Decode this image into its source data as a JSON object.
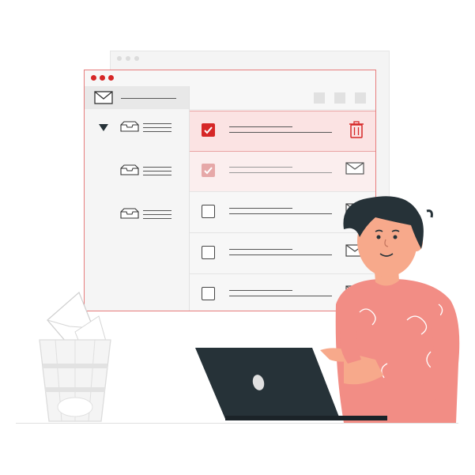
{
  "colors": {
    "accent": "#d62727",
    "accent_light": "#e6a8a8",
    "selected_row": "#fbe3e3",
    "window_border": "#e77c7c",
    "shirt": "#f28d85",
    "skin": "#f7a98b",
    "hair": "#263238",
    "laptop": "#263238"
  },
  "mail_window": {
    "sidebar": {
      "header_icon": "envelope-icon",
      "folders": [
        {
          "icon": "inbox-icon",
          "expanded": true
        },
        {
          "icon": "inbox-icon",
          "expanded": false
        },
        {
          "icon": "inbox-icon",
          "expanded": false
        }
      ]
    },
    "messages": [
      {
        "checked": true,
        "state": "selected",
        "action_icon": "trash-icon"
      },
      {
        "checked": true,
        "state": "faded",
        "action_icon": "envelope-icon"
      },
      {
        "checked": false,
        "state": "normal",
        "action_icon": "envelope-icon"
      },
      {
        "checked": false,
        "state": "normal",
        "action_icon": "envelope-icon"
      },
      {
        "checked": false,
        "state": "normal",
        "action_icon": "envelope-icon"
      }
    ]
  },
  "scene": {
    "person": "man-pointing-at-laptop",
    "trash_bin": "wastebasket-with-paper"
  }
}
